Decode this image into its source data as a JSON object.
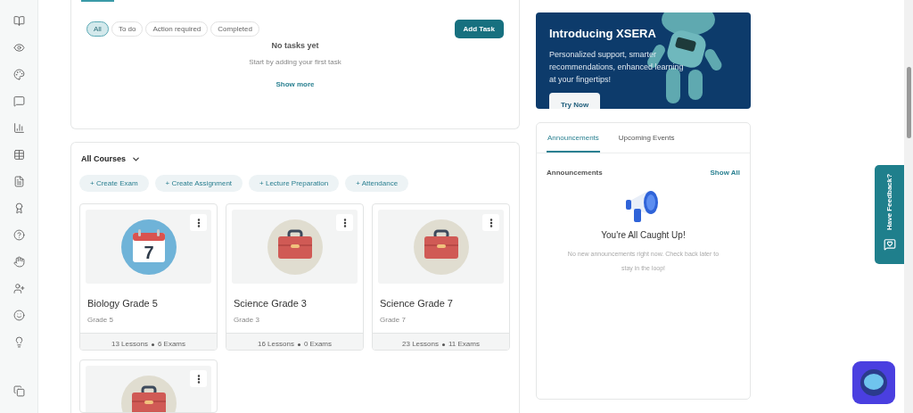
{
  "tasks": {
    "filters": [
      {
        "label": "All",
        "selected": true
      },
      {
        "label": "To do",
        "selected": false
      },
      {
        "label": "Action required",
        "selected": false
      },
      {
        "label": "Completed",
        "selected": false
      }
    ],
    "add_button": "Add Task",
    "empty_title": "No tasks yet",
    "empty_text": "Start by adding your first task",
    "show_more": "Show more"
  },
  "courses": {
    "title": "All Courses",
    "actions": [
      "+ Create Exam",
      "+ Create Assignment",
      "+ Lecture Preparation",
      "+ Attendance"
    ],
    "items": [
      {
        "kind": "calendar",
        "day": "7",
        "title": "Biology Grade 5",
        "grade": "Grade 5",
        "lessons": "13 Lessons",
        "exams": "6 Exams"
      },
      {
        "kind": "toolbox",
        "title": "Science Grade 3",
        "grade": "Grade 3",
        "lessons": "16 Lessons",
        "exams": "0 Exams"
      },
      {
        "kind": "toolbox",
        "title": "Science Grade 7",
        "grade": "Grade 7",
        "lessons": "23 Lessons",
        "exams": "11 Exams"
      },
      {
        "kind": "toolbox"
      }
    ]
  },
  "banner": {
    "title": "Introducing XSERA",
    "text": "Personalized support, smarter recommendations, enhanced learning at your fingertips!",
    "button": "Try Now"
  },
  "panel": {
    "tabs": [
      {
        "label": "Announcements",
        "selected": true
      },
      {
        "label": "Upcoming Events",
        "selected": false
      }
    ],
    "heading": "Announcements",
    "show_all": "Show All",
    "empty_title": "You're All Caught Up!",
    "empty_text": "No new announcements right now. Check back later to stay in the loop!"
  },
  "feedback": "Have Feedback?"
}
